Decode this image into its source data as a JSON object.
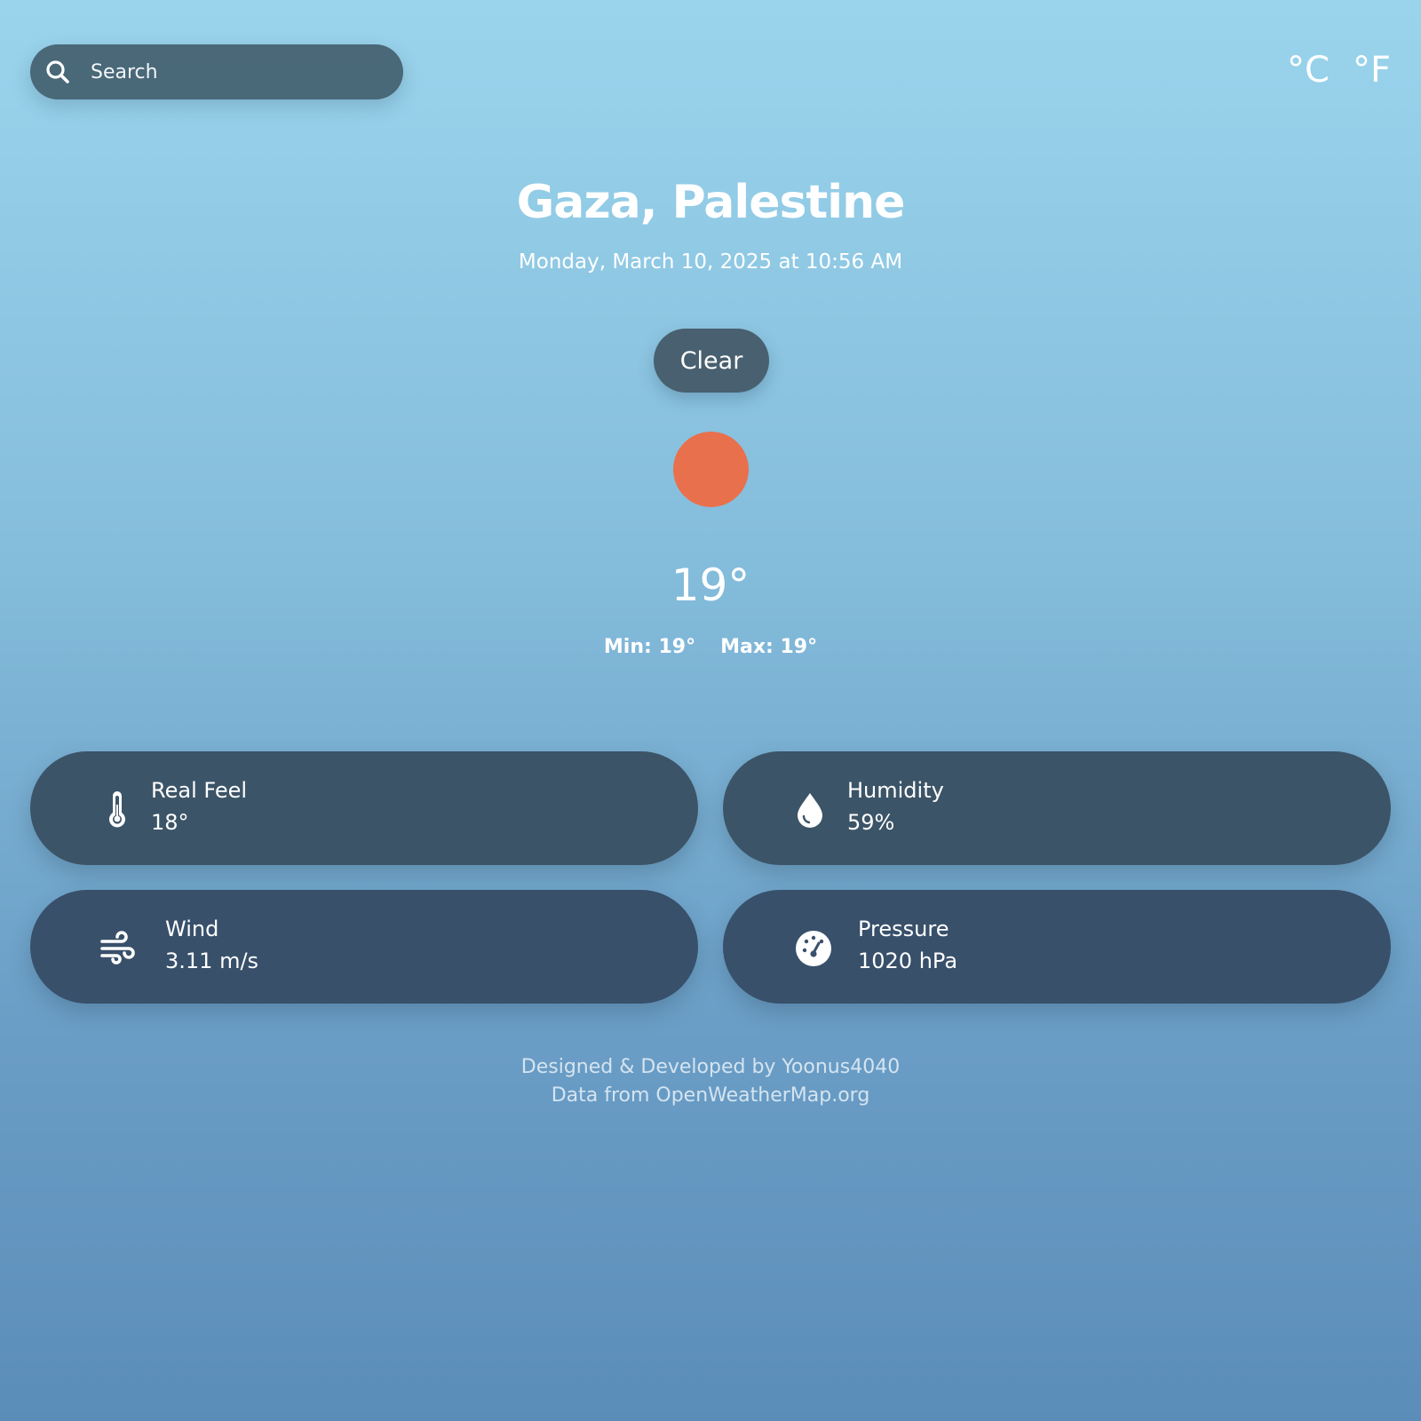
{
  "search": {
    "placeholder": "Search",
    "icon": "search-icon"
  },
  "units": {
    "celsius": "°C",
    "fahrenheit": "°F"
  },
  "location": {
    "name": "Gaza, Palestine",
    "datetime": "Monday, March 10, 2025 at 10:56 AM"
  },
  "condition": {
    "label": "Clear",
    "icon": "sun-icon",
    "icon_color": "#e9704c"
  },
  "temperature": {
    "current": "19°",
    "min": "Min: 19°",
    "max": "Max: 19°"
  },
  "details": [
    {
      "icon": "thermometer-icon",
      "label": "Real Feel",
      "value": "18°"
    },
    {
      "icon": "water-drop-icon",
      "label": "Humidity",
      "value": "59%"
    },
    {
      "icon": "wind-icon",
      "label": "Wind",
      "value": "3.11 m/s"
    },
    {
      "icon": "gauge-icon",
      "label": "Pressure",
      "value": "1020 hPa"
    }
  ],
  "footer": {
    "credit": "Designed & Developed by Yoonus4040",
    "data_source": "Data from OpenWeatherMap.org"
  },
  "colors": {
    "card_background": "#3c5467",
    "search_background": "#3f5968",
    "background_top": "#9ad4ec",
    "background_bottom": "#5b8db9"
  }
}
